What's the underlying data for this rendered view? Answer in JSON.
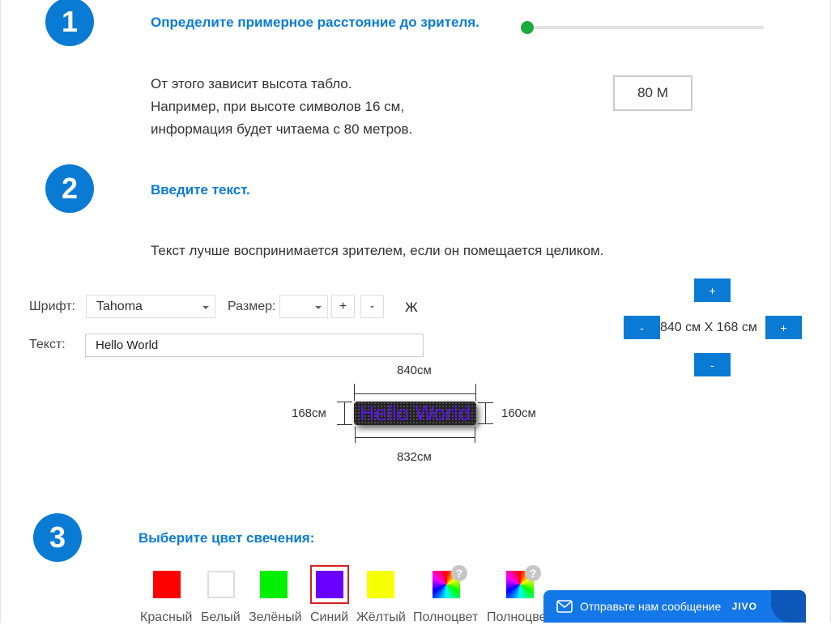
{
  "step1": {
    "number": "1",
    "title": "Определите примерное расстояние до зрителя.",
    "desc": [
      "От этого зависит высота табло.",
      "Например, при высоте символов 16 см,",
      "информация будет читаема с 80 метров."
    ],
    "distance_value": "80 М",
    "slider_fraction": 0.0
  },
  "step2": {
    "number": "2",
    "title": "Введите текст.",
    "desc": "Текст лучше воспринимается зрителем, если он помещается целиком.",
    "font_label": "Шрифт:",
    "font_value": "Tahoma",
    "size_label": "Размер:",
    "size_value": "",
    "plus": "+",
    "minus": "-",
    "bold_label": "Ж",
    "text_label": "Текст:",
    "text_value": "Hello World",
    "dims": "840 см X 168 см",
    "board_text": "Hello World",
    "board_width": "840см",
    "board_height": "168см",
    "board_inner_height": "160см",
    "board_inner_width": "832см"
  },
  "step3": {
    "number": "3",
    "title": "Выберите цвет свечения:",
    "colors": [
      {
        "label": "Красный",
        "hex": "#ff0000"
      },
      {
        "label": "Белый",
        "hex": "#ffffff"
      },
      {
        "label": "Зелёный",
        "hex": "#00f000"
      },
      {
        "label": "Синий",
        "hex": "#6a00ff"
      },
      {
        "label": "Жёлтый",
        "hex": "#f7ff00"
      },
      {
        "label": "Полноцвет",
        "hex": "rainbow"
      },
      {
        "label": "Полноцве",
        "hex": "rainbow"
      }
    ],
    "selected": "Синий",
    "help": "?"
  },
  "chat": {
    "label": "Отправьте нам сообщение",
    "brand": "JIVO"
  },
  "colors": {
    "accent": "#0a7bd5",
    "slider_thumb": "#1aad3c",
    "selection": "#d42020",
    "chat": "#1477e8"
  }
}
